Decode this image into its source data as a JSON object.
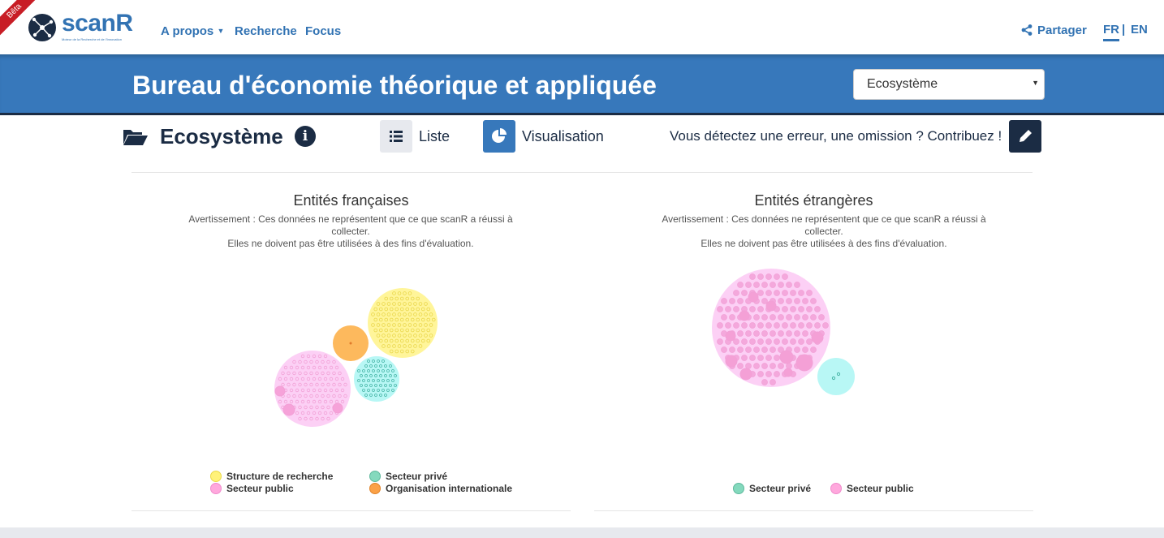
{
  "brand": {
    "name": "scanR",
    "tagline": "Moteur de la Recherche et de l'Innovation",
    "beta": "Bêta"
  },
  "nav": {
    "apropos": "A propos",
    "recherche": "Recherche",
    "focus": "Focus"
  },
  "header_right": {
    "share": "Partager",
    "lang_fr": "FR",
    "lang_sep": "|",
    "lang_en": "EN"
  },
  "banner": {
    "title": "Bureau d'économie théorique et appliquée",
    "select_value": "Ecosystème"
  },
  "section": {
    "title": "Ecosystème",
    "list_label": "Liste",
    "viz_label": "Visualisation",
    "contrib_text": "Vous détectez une erreur, une omission ? Contribuez !"
  },
  "panels": {
    "french": {
      "title": "Entités françaises",
      "note_line1": "Avertissement : Ces données ne représentent que ce que scanR a réussi à collecter.",
      "note_line2": "Elles ne doivent pas être utilisées à des fins d'évaluation.",
      "legend": [
        {
          "label": "Structure de recherche",
          "color": "#fff27a"
        },
        {
          "label": "Secteur privé",
          "color": "#84d9bd"
        },
        {
          "label": "Secteur public",
          "color": "#ffa8dd"
        },
        {
          "label": "Organisation internationale",
          "color": "#fba147"
        }
      ]
    },
    "foreign": {
      "title": "Entités étrangères",
      "note_line1": "Avertissement : Ces données ne représentent que ce que scanR a réussi à collecter.",
      "note_line2": "Elles ne doivent pas être utilisées à des fins d'évaluation.",
      "legend": [
        {
          "label": "Secteur privé",
          "color": "#84d9bd"
        },
        {
          "label": "Secteur public",
          "color": "#ffa8dd"
        }
      ]
    }
  },
  "colors": {
    "brand_blue": "#3778bb",
    "navy": "#1b2c44",
    "public_fill": "#fcd0f5",
    "public_dot": "#f2a0d6",
    "research_fill": "#fff59a",
    "research_dot": "#e9d64a",
    "private_fill": "#b8f7f5",
    "private_dot": "#47b5a6",
    "intl_fill": "#fdb95d"
  }
}
